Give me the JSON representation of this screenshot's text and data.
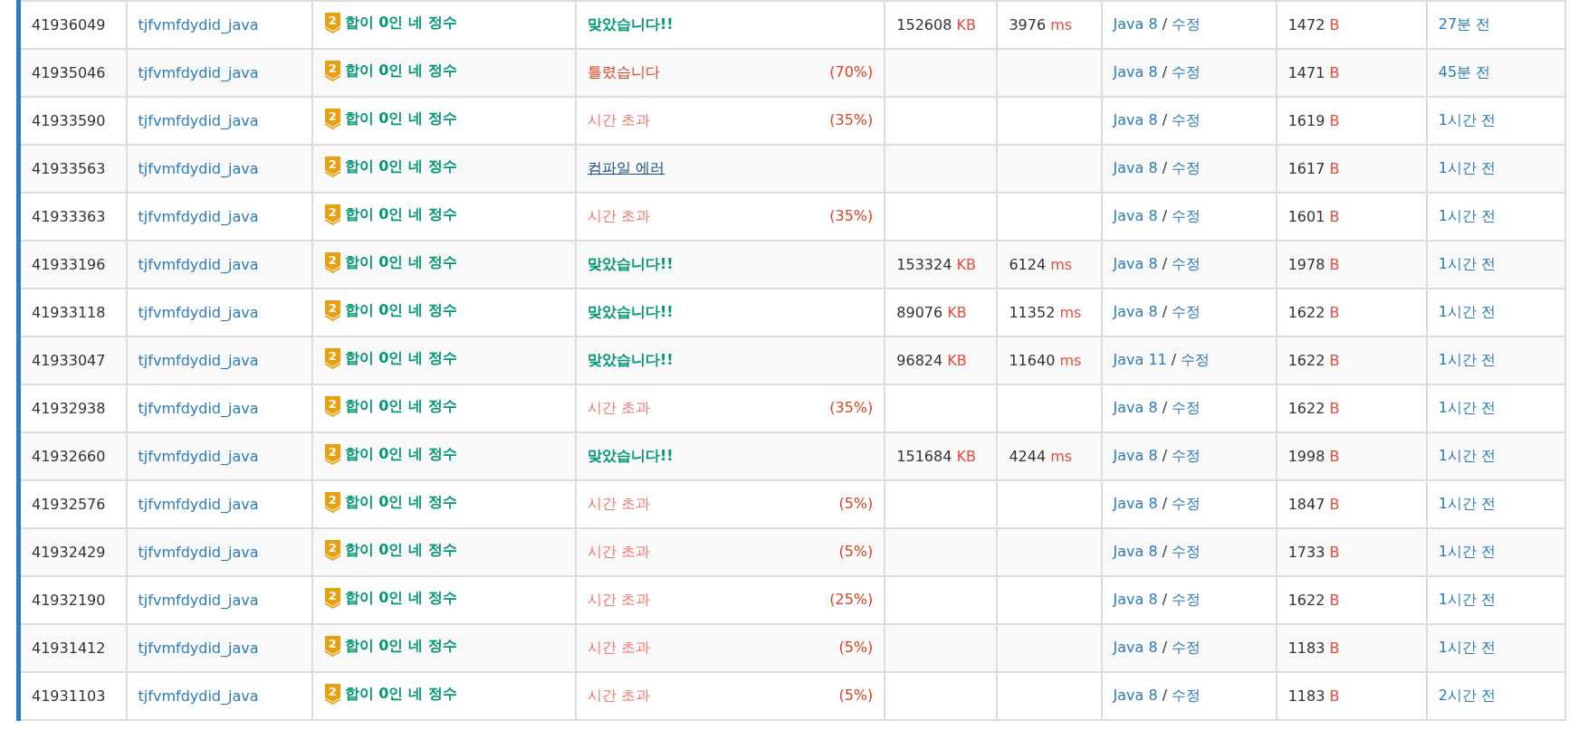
{
  "submissions": [
    {
      "id": "41936049",
      "user": "tjfvmfdydid_java",
      "tier": "2",
      "problem": "합이 0인 네 정수",
      "result": {
        "kind": "ac",
        "text": "맞았습니다!!"
      },
      "memory": "152608",
      "memory_unit": "KB",
      "time": "3976",
      "time_unit": "ms",
      "language": "Java 8",
      "separator": "/",
      "edit": "수정",
      "length": "1472",
      "length_unit": "B",
      "ago": "27분 전"
    },
    {
      "id": "41935046",
      "user": "tjfvmfdydid_java",
      "tier": "2",
      "problem": "합이 0인 네 정수",
      "result": {
        "kind": "wa",
        "text": "틀렸습니다",
        "percent": "(70%)"
      },
      "language": "Java 8",
      "separator": "/",
      "edit": "수정",
      "length": "1471",
      "length_unit": "B",
      "ago": "45분 전"
    },
    {
      "id": "41933590",
      "user": "tjfvmfdydid_java",
      "tier": "2",
      "problem": "합이 0인 네 정수",
      "result": {
        "kind": "tle",
        "text": "시간 초과",
        "percent": "(35%)"
      },
      "language": "Java 8",
      "separator": "/",
      "edit": "수정",
      "length": "1619",
      "length_unit": "B",
      "ago": "1시간 전"
    },
    {
      "id": "41933563",
      "user": "tjfvmfdydid_java",
      "tier": "2",
      "problem": "합이 0인 네 정수",
      "result": {
        "kind": "ce",
        "text": "컴파일 에러"
      },
      "language": "Java 8",
      "separator": "/",
      "edit": "수정",
      "length": "1617",
      "length_unit": "B",
      "ago": "1시간 전"
    },
    {
      "id": "41933363",
      "user": "tjfvmfdydid_java",
      "tier": "2",
      "problem": "합이 0인 네 정수",
      "result": {
        "kind": "tle",
        "text": "시간 초과",
        "percent": "(35%)"
      },
      "language": "Java 8",
      "separator": "/",
      "edit": "수정",
      "length": "1601",
      "length_unit": "B",
      "ago": "1시간 전"
    },
    {
      "id": "41933196",
      "user": "tjfvmfdydid_java",
      "tier": "2",
      "problem": "합이 0인 네 정수",
      "result": {
        "kind": "ac",
        "text": "맞았습니다!!"
      },
      "memory": "153324",
      "memory_unit": "KB",
      "time": "6124",
      "time_unit": "ms",
      "language": "Java 8",
      "separator": "/",
      "edit": "수정",
      "length": "1978",
      "length_unit": "B",
      "ago": "1시간 전"
    },
    {
      "id": "41933118",
      "user": "tjfvmfdydid_java",
      "tier": "2",
      "problem": "합이 0인 네 정수",
      "result": {
        "kind": "ac",
        "text": "맞았습니다!!"
      },
      "memory": "89076",
      "memory_unit": "KB",
      "time": "11352",
      "time_unit": "ms",
      "language": "Java 8",
      "separator": "/",
      "edit": "수정",
      "length": "1622",
      "length_unit": "B",
      "ago": "1시간 전"
    },
    {
      "id": "41933047",
      "user": "tjfvmfdydid_java",
      "tier": "2",
      "problem": "합이 0인 네 정수",
      "result": {
        "kind": "ac",
        "text": "맞았습니다!!"
      },
      "memory": "96824",
      "memory_unit": "KB",
      "time": "11640",
      "time_unit": "ms",
      "language": "Java 11",
      "separator": "/",
      "edit": "수정",
      "length": "1622",
      "length_unit": "B",
      "ago": "1시간 전"
    },
    {
      "id": "41932938",
      "user": "tjfvmfdydid_java",
      "tier": "2",
      "problem": "합이 0인 네 정수",
      "result": {
        "kind": "tle",
        "text": "시간 초과",
        "percent": "(35%)"
      },
      "language": "Java 8",
      "separator": "/",
      "edit": "수정",
      "length": "1622",
      "length_unit": "B",
      "ago": "1시간 전"
    },
    {
      "id": "41932660",
      "user": "tjfvmfdydid_java",
      "tier": "2",
      "problem": "합이 0인 네 정수",
      "result": {
        "kind": "ac",
        "text": "맞았습니다!!"
      },
      "memory": "151684",
      "memory_unit": "KB",
      "time": "4244",
      "time_unit": "ms",
      "language": "Java 8",
      "separator": "/",
      "edit": "수정",
      "length": "1998",
      "length_unit": "B",
      "ago": "1시간 전"
    },
    {
      "id": "41932576",
      "user": "tjfvmfdydid_java",
      "tier": "2",
      "problem": "합이 0인 네 정수",
      "result": {
        "kind": "tle",
        "text": "시간 초과",
        "percent": "(5%)"
      },
      "language": "Java 8",
      "separator": "/",
      "edit": "수정",
      "length": "1847",
      "length_unit": "B",
      "ago": "1시간 전"
    },
    {
      "id": "41932429",
      "user": "tjfvmfdydid_java",
      "tier": "2",
      "problem": "합이 0인 네 정수",
      "result": {
        "kind": "tle",
        "text": "시간 초과",
        "percent": "(5%)"
      },
      "language": "Java 8",
      "separator": "/",
      "edit": "수정",
      "length": "1733",
      "length_unit": "B",
      "ago": "1시간 전"
    },
    {
      "id": "41932190",
      "user": "tjfvmfdydid_java",
      "tier": "2",
      "problem": "합이 0인 네 정수",
      "result": {
        "kind": "tle",
        "text": "시간 초과",
        "percent": "(25%)"
      },
      "language": "Java 8",
      "separator": "/",
      "edit": "수정",
      "length": "1622",
      "length_unit": "B",
      "ago": "1시간 전"
    },
    {
      "id": "41931412",
      "user": "tjfvmfdydid_java",
      "tier": "2",
      "problem": "합이 0인 네 정수",
      "result": {
        "kind": "tle",
        "text": "시간 초과",
        "percent": "(5%)"
      },
      "language": "Java 8",
      "separator": "/",
      "edit": "수정",
      "length": "1183",
      "length_unit": "B",
      "ago": "1시간 전"
    },
    {
      "id": "41931103",
      "user": "tjfvmfdydid_java",
      "tier": "2",
      "problem": "합이 0인 네 정수",
      "result": {
        "kind": "tle",
        "text": "시간 초과",
        "percent": "(5%)"
      },
      "language": "Java 8",
      "separator": "/",
      "edit": "수정",
      "length": "1183",
      "length_unit": "B",
      "ago": "2시간 전"
    }
  ]
}
